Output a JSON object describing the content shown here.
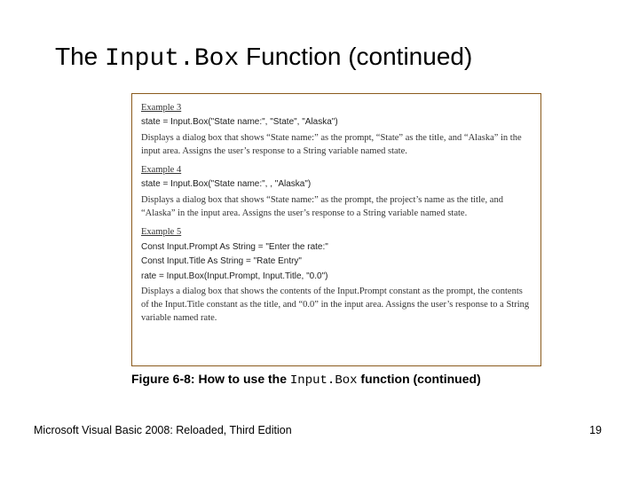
{
  "title": {
    "pre": "The ",
    "code": "Input.Box",
    "post": " Function (continued)"
  },
  "examples": [
    {
      "label": "Example 3",
      "code": [
        "state = Input.Box(\"State name:\", \"State\", \"Alaska\")"
      ],
      "desc": "Displays a dialog box that shows “State name:” as the prompt, “State” as the title, and “Alaska” in the input area. Assigns the user’s response to a String variable named state."
    },
    {
      "label": "Example 4",
      "code": [
        "state = Input.Box(\"State name:\", , \"Alaska\")"
      ],
      "desc": "Displays a dialog box that shows “State name:” as the prompt, the project’s name as the title, and “Alaska” in the input area. Assigns the user’s response to a String variable named state."
    },
    {
      "label": "Example 5",
      "code": [
        "Const Input.Prompt As String = \"Enter the rate:\"",
        "Const Input.Title As String = \"Rate Entry\"",
        "rate = Input.Box(Input.Prompt, Input.Title, \"0.0\")"
      ],
      "desc": "Displays a dialog box that shows the contents of the Input.Prompt constant as the prompt, the contents of the Input.Title constant as the title, and “0.0” in the input area. Assigns the user’s response to a String variable named rate."
    }
  ],
  "caption": {
    "pre": "Figure 6-8: How to use the ",
    "code": "Input.Box",
    "post": " function (continued)"
  },
  "footer": {
    "left": "Microsoft Visual Basic 2008: Reloaded, Third Edition",
    "right": "19"
  }
}
